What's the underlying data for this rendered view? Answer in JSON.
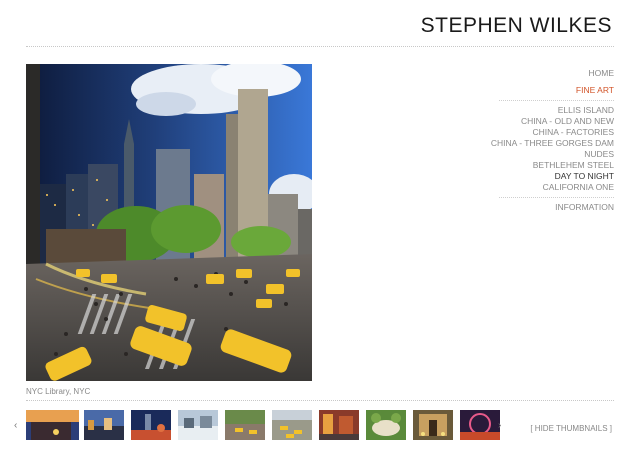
{
  "site": {
    "title": "STEPHEN WILKES"
  },
  "nav": {
    "items": [
      {
        "label": "HOME"
      },
      {
        "label": "FINE ART"
      },
      {
        "label": "ELLIS ISLAND"
      },
      {
        "label": "CHINA - OLD AND NEW"
      },
      {
        "label": "CHINA - FACTORIES"
      },
      {
        "label": "CHINA - THREE GORGES DAM"
      },
      {
        "label": "NUDES"
      },
      {
        "label": "BETHLEHEM STEEL"
      },
      {
        "label": "DAY TO NIGHT"
      },
      {
        "label": "CALIFORNIA ONE"
      },
      {
        "label": "INFORMATION"
      }
    ],
    "active_color": "#d2552a"
  },
  "photo": {
    "caption": "NYC Library, NYC"
  },
  "thumbnails": {
    "prev_arrow": "‹",
    "next_arrow": "›",
    "hide_label": "[ HIDE THUMBNAILS ]",
    "count": 10
  }
}
